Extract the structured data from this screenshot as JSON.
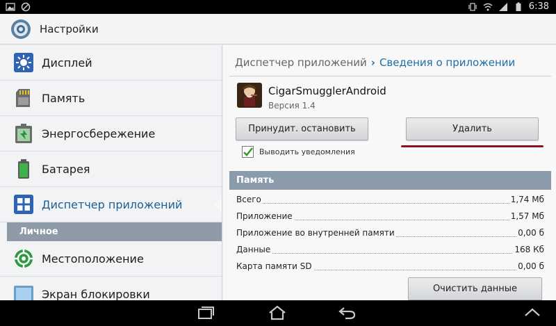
{
  "status_bar": {
    "time": "6:38"
  },
  "action_bar": {
    "title": "Настройки"
  },
  "sidebar": {
    "items": [
      {
        "label": "Дисплей"
      },
      {
        "label": "Память"
      },
      {
        "label": "Энергосбережение"
      },
      {
        "label": "Батарея"
      },
      {
        "label": "Диспетчер приложений"
      }
    ],
    "section_header": "Личное",
    "items2": [
      {
        "label": "Местоположение"
      },
      {
        "label": "Экран блокировки"
      }
    ]
  },
  "breadcrumb": {
    "parent": "Диспетчер приложений",
    "separator": "›",
    "current": "Сведения о приложении"
  },
  "app": {
    "name": "CigarSmugglerAndroid",
    "version": "Версия 1.4"
  },
  "buttons": {
    "force_stop": "Принудит. остановить",
    "uninstall": "Удалить",
    "clear_data": "Очистить данные"
  },
  "notifications": {
    "label": "Выводить уведомления",
    "checked": true
  },
  "memory": {
    "header": "Память",
    "rows": [
      {
        "label": "Всего",
        "value": "1,74 Мб"
      },
      {
        "label": "Приложение",
        "value": "1,57 Мб"
      },
      {
        "label": "Приложение во внутренней памяти",
        "value": "0,00 б"
      },
      {
        "label": "Данные",
        "value": "168 Кб"
      },
      {
        "label": "Карта памяти SD",
        "value": "0,00 б"
      }
    ]
  },
  "colors": {
    "accent": "#1e6ea5",
    "section_header": "#8e9aa7",
    "underline": "#8b1321"
  }
}
